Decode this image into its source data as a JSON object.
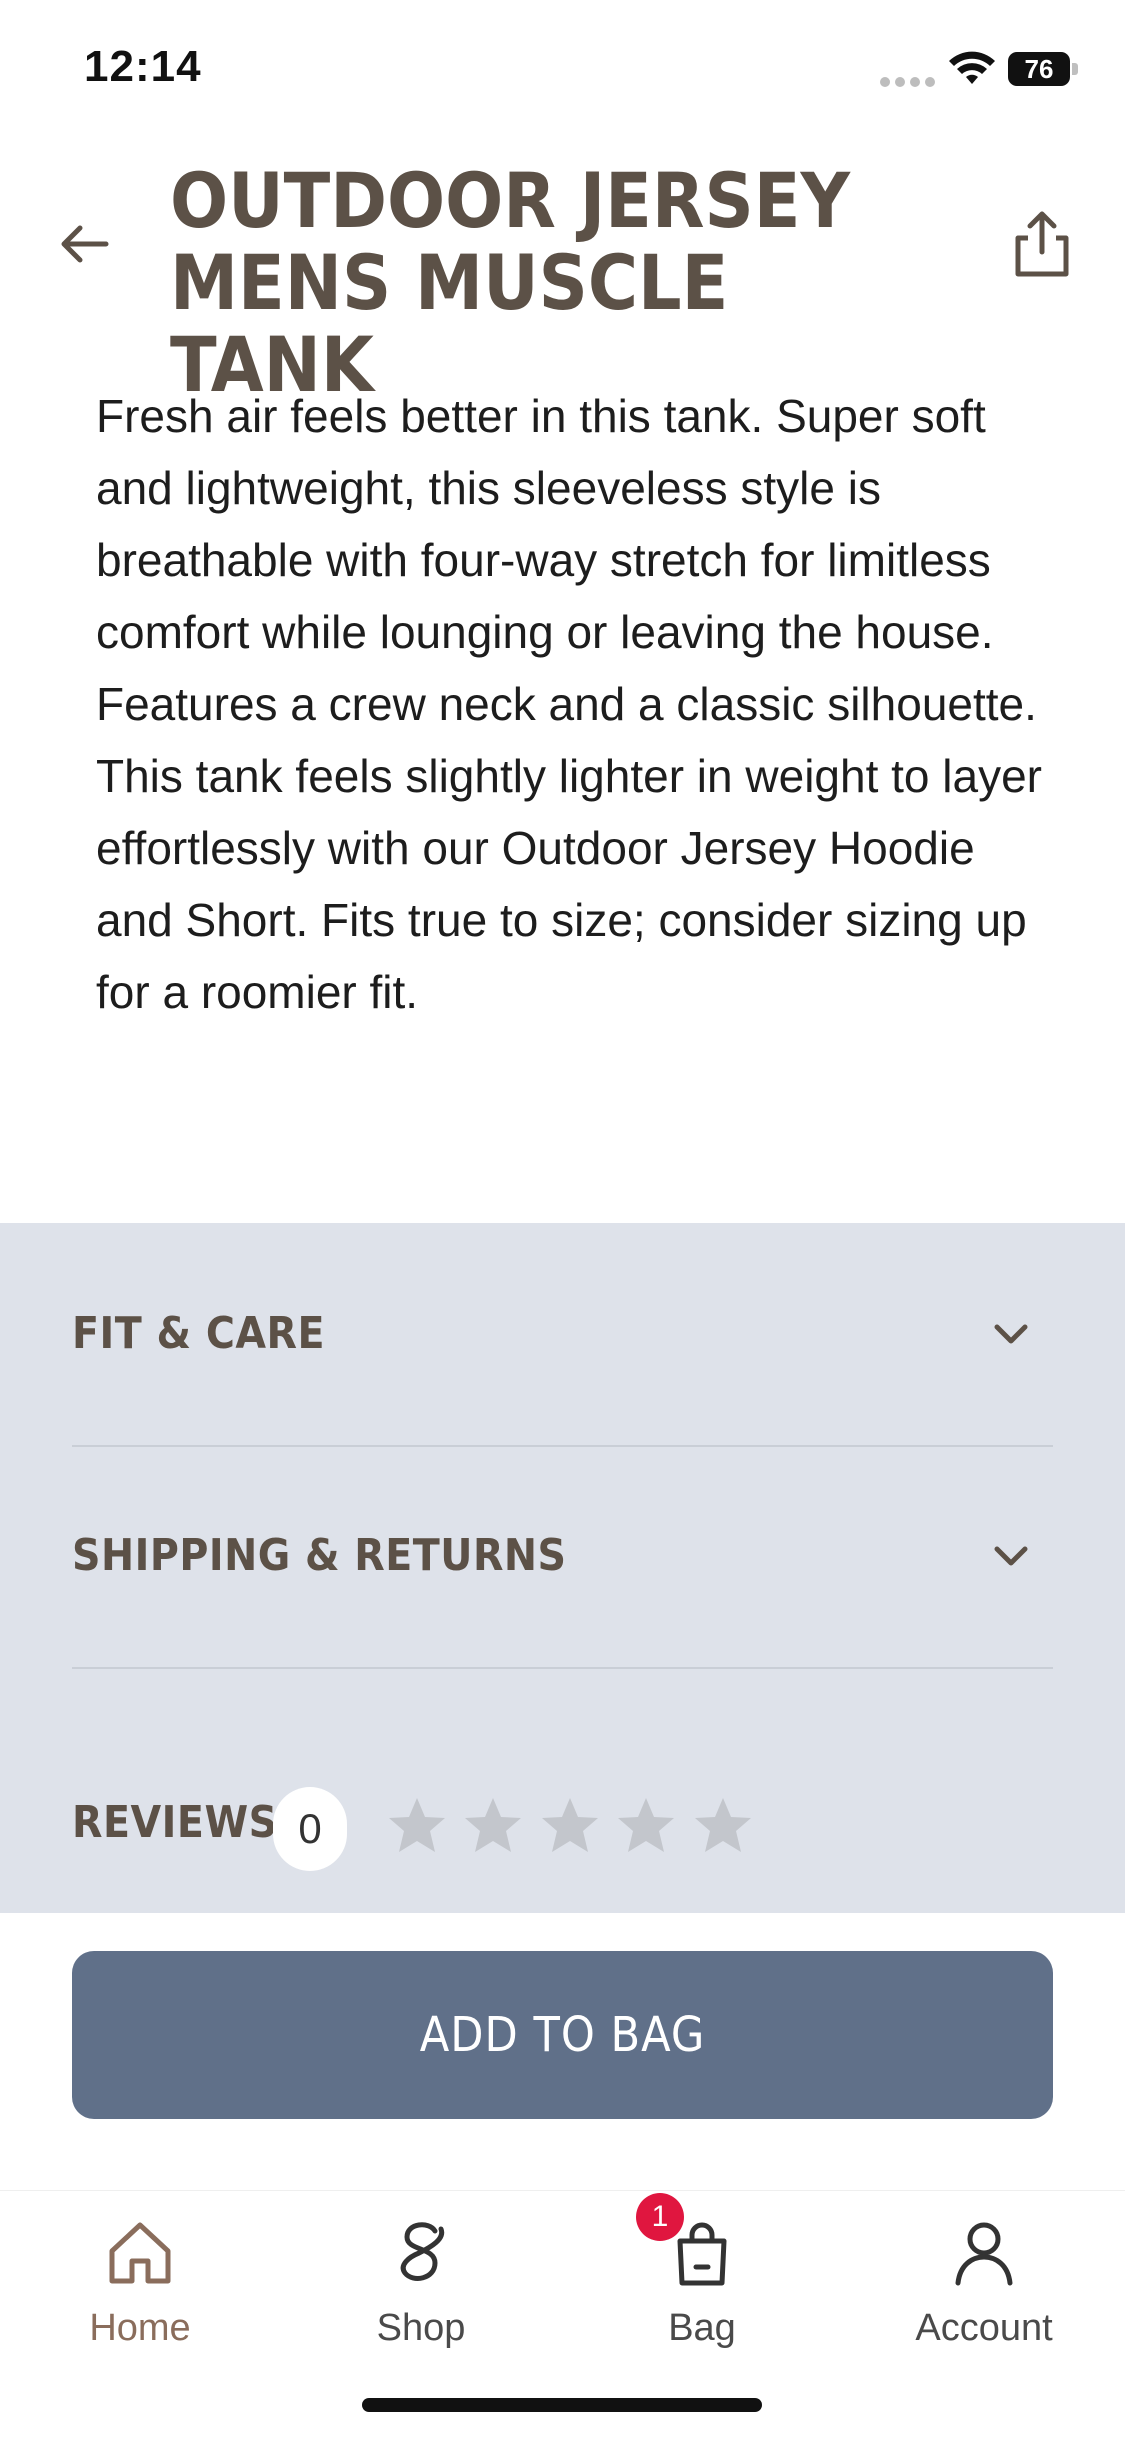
{
  "status_bar": {
    "time": "12:14",
    "battery": "76"
  },
  "header": {
    "title": "OUTDOOR JERSEY MENS MUSCLE TANK"
  },
  "description": "Fresh air feels better in this tank. Super soft and lightweight, this sleeveless style is breathable with four-way stretch for limitless comfort while lounging or leaving the house. Features a crew neck and a classic silhouette. This tank feels slightly lighter in weight to layer effortlessly with our Outdoor Jersey Hoodie and Short. Fits true to size; consider sizing up for a roomier fit.",
  "accordion": [
    {
      "label": "FIT & CARE"
    },
    {
      "label": "SHIPPING & RETURNS"
    }
  ],
  "reviews": {
    "label": "REVIEWS",
    "count": "0",
    "rating": 0,
    "max_rating": 5
  },
  "cta": {
    "label": "ADD TO BAG"
  },
  "tab_bar": {
    "items": [
      {
        "label": "Home",
        "icon": "home-icon",
        "active": true
      },
      {
        "label": "Shop",
        "icon": "shop-icon",
        "active": false
      },
      {
        "label": "Bag",
        "icon": "bag-icon",
        "active": false,
        "badge": "1"
      },
      {
        "label": "Account",
        "icon": "account-icon",
        "active": false
      }
    ]
  },
  "colors": {
    "title": "#5c5147",
    "accordion_bg": "#dee2ea",
    "button": "#607089",
    "active_tab": "#8a6d5c",
    "badge": "#e0163f"
  }
}
